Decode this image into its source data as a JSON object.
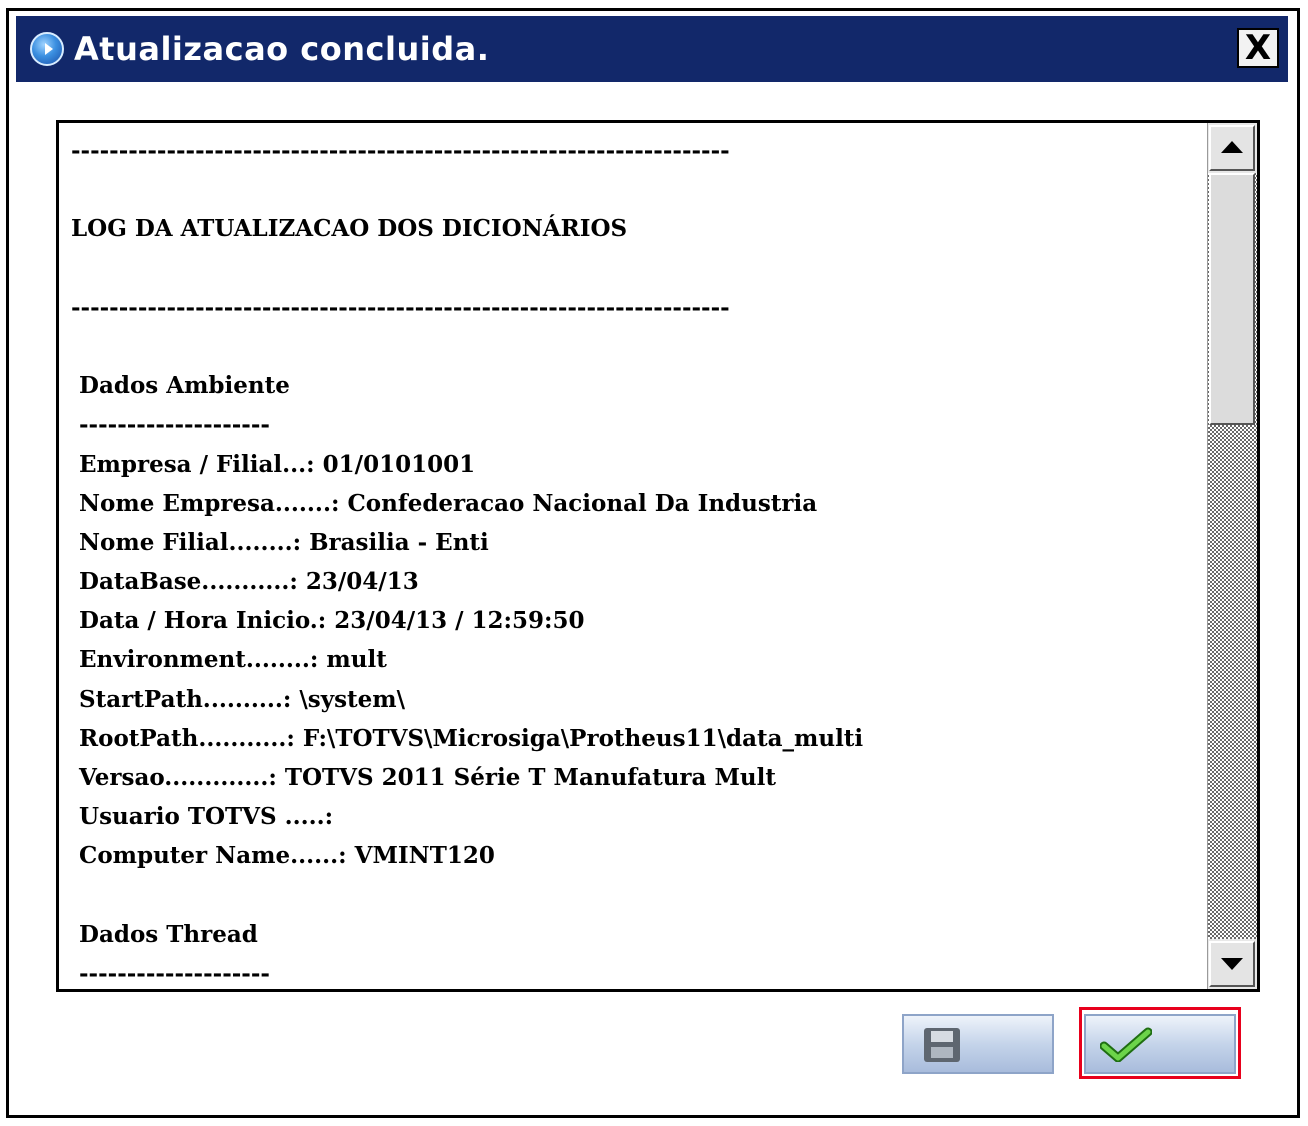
{
  "window": {
    "title": "Atualizacao concluida.",
    "close_label": "X"
  },
  "log": {
    "lines": [
      "---------------------------------------------------------------------",
      "",
      "LOG DA ATUALIZACAO DOS DICIONÁRIOS",
      "",
      "---------------------------------------------------------------------",
      "",
      " Dados Ambiente",
      " --------------------",
      " Empresa / Filial...: 01/0101001",
      " Nome Empresa.......: Confederacao Nacional Da Industria",
      " Nome Filial........: Brasilia - Enti",
      " DataBase...........: 23/04/13",
      " Data / Hora Inicio.: 23/04/13 / 12:59:50",
      " Environment........: mult",
      " StartPath..........: \\system\\",
      " RootPath...........: F:\\TOTVS\\Microsiga\\Protheus11\\data_multi",
      " Versao.............: TOTVS 2011 Série T Manufatura Mult",
      " Usuario TOTVS .....:",
      " Computer Name......: VMINT120",
      "",
      " Dados Thread",
      " --------------------"
    ]
  },
  "buttons": {
    "save_icon": "floppy-disk-icon",
    "confirm_icon": "checkmark-icon"
  },
  "colors": {
    "titlebar": "#12286a",
    "highlight": "#e8001c"
  }
}
